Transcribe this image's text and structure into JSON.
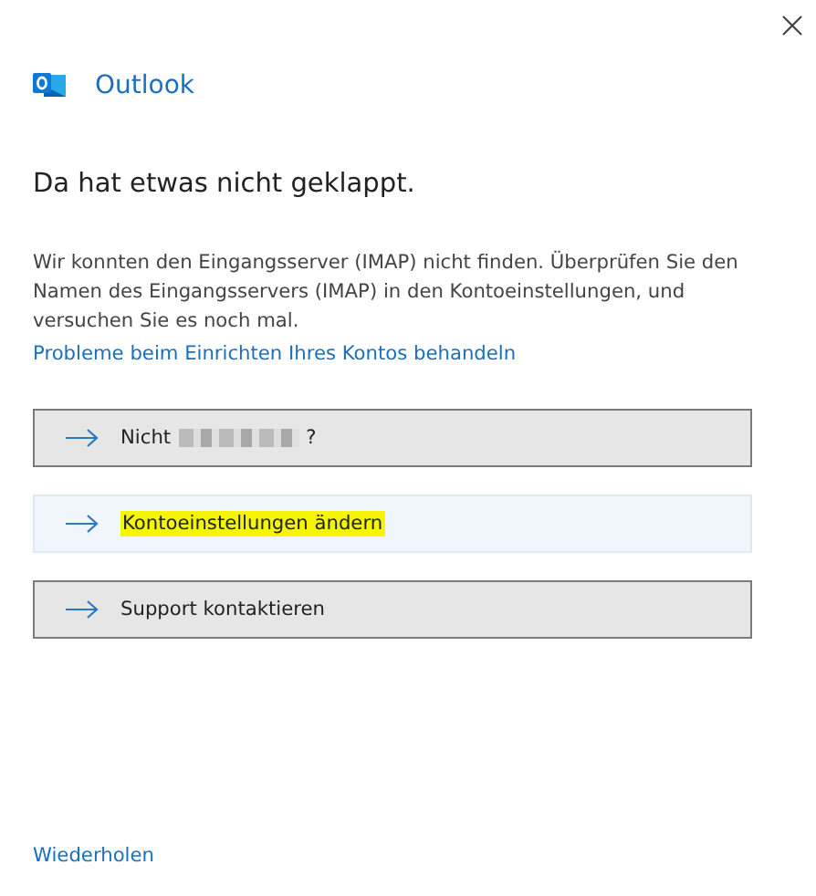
{
  "title": "Outlook",
  "heading": "Da hat etwas nicht geklappt.",
  "message": "Wir konnten den Eingangsserver (IMAP) nicht finden. Überprüfen Sie den Namen des Eingangsservers (IMAP) in den Kontoeinstellungen, und versuchen Sie es noch mal.",
  "help_link": "Probleme beim Einrichten Ihres Kontos behandeln",
  "options": [
    {
      "label": "Nicht",
      "suffix": "?",
      "redacted": true,
      "hovered": false,
      "highlighted": false
    },
    {
      "label": "Kontoeinstellungen ändern",
      "redacted": false,
      "hovered": true,
      "highlighted": true
    },
    {
      "label": "Support kontaktieren",
      "redacted": false,
      "hovered": false,
      "highlighted": false
    }
  ],
  "retry_link": "Wiederholen"
}
